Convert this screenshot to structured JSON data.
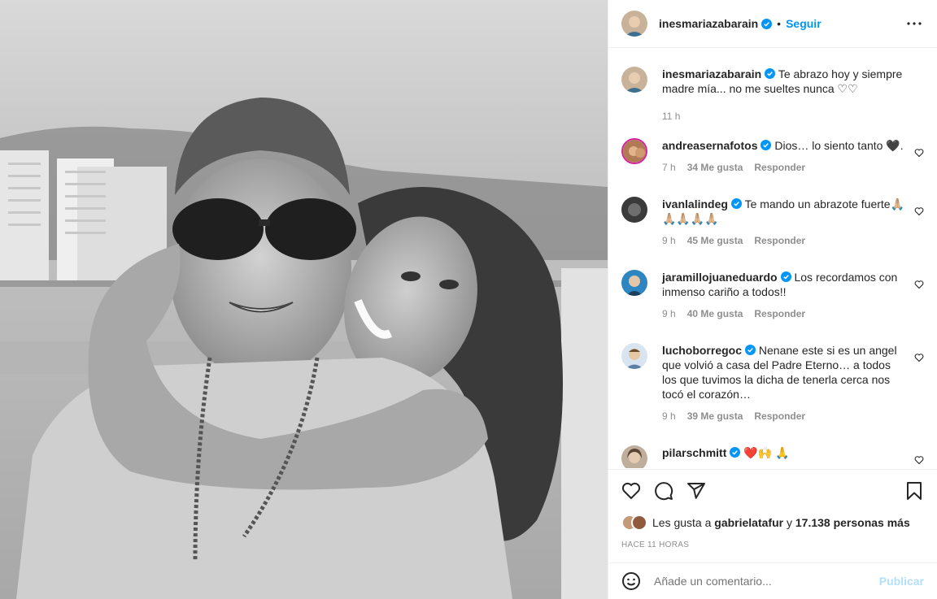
{
  "post": {
    "username": "inesmariazabarain",
    "follow_label": "Seguir",
    "separator": "•",
    "caption_text": "Te abrazo hoy y siempre madre mía... no me sueltes nunca ♡♡",
    "caption_time": "11 h"
  },
  "comments": [
    {
      "username": "andreasernafotos",
      "text": "Dios… lo siento tanto 🖤.",
      "time": "7 h",
      "likes": "34 Me gusta",
      "reply": "Responder"
    },
    {
      "username": "ivanlalindeg",
      "text": "Te mando un abrazote fuerte🙏🏼🙏🏼🙏🏼🙏🏼🙏🏼",
      "time": "9 h",
      "likes": "45 Me gusta",
      "reply": "Responder"
    },
    {
      "username": "jaramillojuaneduardo",
      "text": "Los recordamos con inmenso cariño a todos!!",
      "time": "9 h",
      "likes": "40 Me gusta",
      "reply": "Responder"
    },
    {
      "username": "luchoborregoc",
      "text": "Nenane este si es un angel que volvió a casa del Padre Eterno… a todos los que tuvimos la dicha de tenerla cerca nos tocó el corazón…",
      "time": "9 h",
      "likes": "39 Me gusta",
      "reply": "Responder"
    },
    {
      "username": "pilarschmitt",
      "text": "❤️🙌 🙏",
      "time": "",
      "likes": "",
      "reply": ""
    }
  ],
  "likes": {
    "prefix": "Les gusta a",
    "user": "gabrielatafur",
    "connector": "y",
    "others": "17.138 personas más"
  },
  "timestamp": "HACE 11 HORAS",
  "add_comment": {
    "placeholder": "Añade un comentario...",
    "post_label": "Publicar"
  },
  "colors": {
    "link": "#0095f6",
    "verified": "#0095f6",
    "muted": "#8e8e8e",
    "post_disabled": "#b2dffc"
  },
  "icons": [
    "more-icon",
    "verified-icon",
    "heart-icon",
    "comment-icon",
    "share-icon",
    "bookmark-icon",
    "emoji-icon"
  ]
}
